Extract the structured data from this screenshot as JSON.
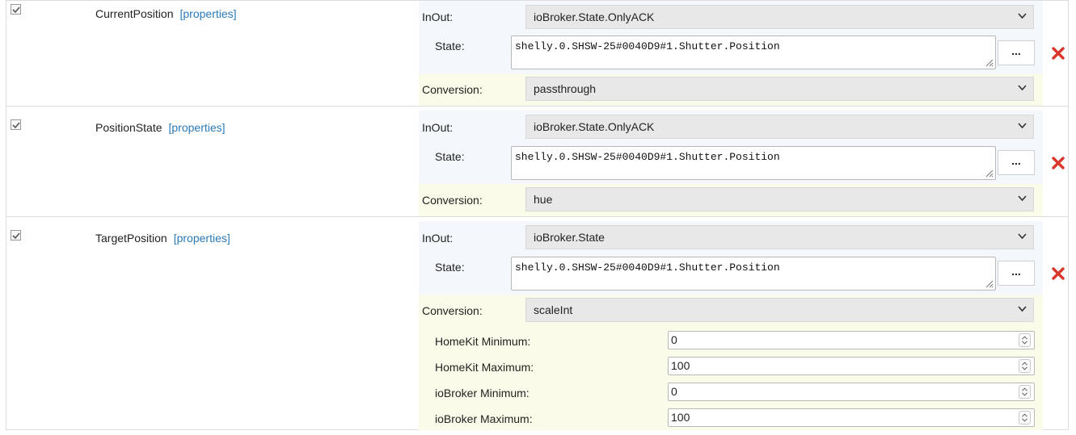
{
  "labels": {
    "properties": "[properties]",
    "inout": "InOut:",
    "state": "State:",
    "conversion": "Conversion:",
    "dots": "..."
  },
  "characteristics": [
    {
      "checked": true,
      "name": "CurrentPosition",
      "inout": "ioBroker.State.OnlyACK",
      "state": "shelly.0.SHSW-25#0040D9#1.Shutter.Position",
      "conversion": "passthrough"
    },
    {
      "checked": true,
      "name": "PositionState",
      "inout": "ioBroker.State.OnlyACK",
      "state": "shelly.0.SHSW-25#0040D9#1.Shutter.Position",
      "conversion": "hue"
    },
    {
      "checked": true,
      "name": "TargetPosition",
      "inout": "ioBroker.State",
      "state": "shelly.0.SHSW-25#0040D9#1.Shutter.Position",
      "conversion": "scaleInt",
      "params": [
        {
          "label": "HomeKit Minimum:",
          "value": "0"
        },
        {
          "label": "HomeKit Maximum:",
          "value": "100"
        },
        {
          "label": "ioBroker Minimum:",
          "value": "0"
        },
        {
          "label": "ioBroker Maximum:",
          "value": "100"
        }
      ]
    }
  ],
  "icons": {
    "checkbox": "checkmark-icon",
    "select": "chevron-down-icon",
    "delete": "red-x-icon",
    "resize": "resize-grip-icon",
    "spinner": "spinner-arrows-icon"
  },
  "colors": {
    "link": "#2a7ab8",
    "delete": "#d9372c",
    "inout_row_bg": "#f4f8fc",
    "conversion_row_bg": "#fbfbe9",
    "select_bg": "#e8e8e8"
  }
}
